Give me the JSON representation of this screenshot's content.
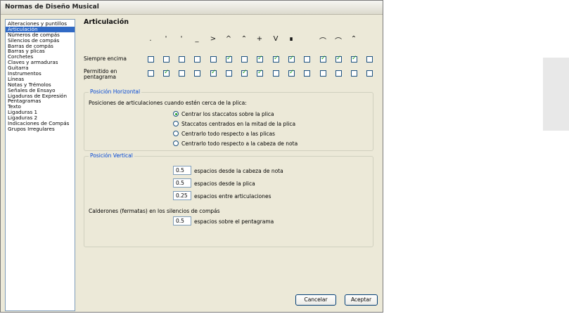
{
  "window": {
    "title": "Normas de Diseño Musical"
  },
  "sidebar": {
    "items": [
      {
        "label": "Alteraciones y puntillos",
        "selected": false
      },
      {
        "label": "Articulación",
        "selected": true
      },
      {
        "label": "Números de compás",
        "selected": false
      },
      {
        "label": "Silencios de compás",
        "selected": false
      },
      {
        "label": "Barras de compás",
        "selected": false
      },
      {
        "label": "Barras y plicas",
        "selected": false
      },
      {
        "label": "Corchetes",
        "selected": false
      },
      {
        "label": "Claves y armaduras",
        "selected": false
      },
      {
        "label": "Guitarra",
        "selected": false
      },
      {
        "label": "Instrumentos",
        "selected": false
      },
      {
        "label": "Líneas",
        "selected": false
      },
      {
        "label": "Notas y Trémolos",
        "selected": false
      },
      {
        "label": "Señales de Ensayo",
        "selected": false
      },
      {
        "label": "Ligaduras de Expresión",
        "selected": false
      },
      {
        "label": "Pentagramas",
        "selected": false
      },
      {
        "label": "Texto",
        "selected": false
      },
      {
        "label": "Ligaduras 1",
        "selected": false
      },
      {
        "label": "Ligaduras 2",
        "selected": false
      },
      {
        "label": "Indicaciones de Compás",
        "selected": false
      },
      {
        "label": "Grupos Irregulares",
        "selected": false
      }
    ]
  },
  "section": {
    "title": "Articulación"
  },
  "articulations": {
    "symbols": [
      ".",
      "'",
      "'",
      "_",
      ">",
      "^",
      "⌃",
      "+",
      "V",
      "∎",
      "",
      "⌒",
      "⌒",
      "⌃",
      ""
    ],
    "rows": [
      {
        "label": "Siempre encima",
        "values": [
          false,
          false,
          false,
          false,
          false,
          true,
          false,
          true,
          true,
          true,
          false,
          true,
          true,
          true,
          false
        ]
      },
      {
        "label": "Permitido en pentagrama",
        "values": [
          false,
          true,
          false,
          false,
          true,
          false,
          true,
          true,
          false,
          true,
          false,
          false,
          false,
          false,
          false
        ]
      }
    ]
  },
  "horizontal": {
    "title": "Posición Horizontal",
    "intro": "Posiciones de articulaciones cuando estén cerca de la plica:",
    "options": [
      {
        "label": "Centrar los staccatos sobre la plica",
        "selected": true
      },
      {
        "label": "Staccatos centrados en la mitad de la plica",
        "selected": false
      },
      {
        "label": "Centrarlo todo respecto a las plicas",
        "selected": false
      },
      {
        "label": "Centrarlo todo respecto a la cabeza de nota",
        "selected": false
      }
    ]
  },
  "vertical": {
    "title": "Posición Vertical",
    "fields": [
      {
        "value": "0.5",
        "label": "espacios desde la cabeza de nota"
      },
      {
        "value": "0.5",
        "label": "espacios desde la plica"
      },
      {
        "value": "0.25",
        "label": "espacios entre articulaciones"
      }
    ],
    "fermata_label": "Calderones (fermatas) en los silencios de compás",
    "fermata_field": {
      "value": "0.5",
      "label": "espacios sobre el pentagrama"
    }
  },
  "buttons": {
    "cancel": "Cancelar",
    "accept": "Aceptar"
  },
  "colors": {
    "selection": "#316ac5",
    "check": "#21a121",
    "group_title": "#0046d5"
  }
}
